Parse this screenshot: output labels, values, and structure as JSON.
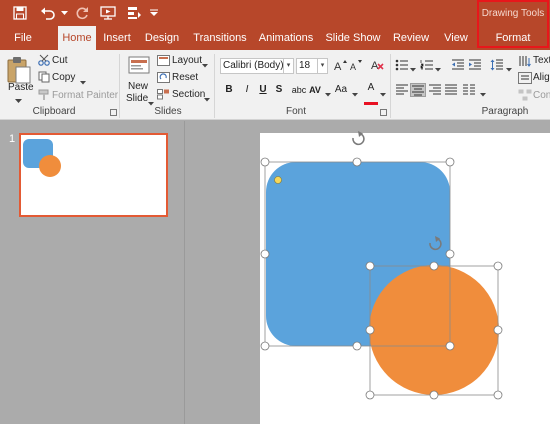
{
  "drawing_tools": {
    "label": "Drawing Tools"
  },
  "qat": [
    {
      "name": "save-icon"
    },
    {
      "name": "undo-icon"
    },
    {
      "name": "redo-icon"
    },
    {
      "name": "start-from-beginning-icon"
    },
    {
      "name": "touch-mouse-mode-icon"
    },
    {
      "name": "customize-qat-icon"
    }
  ],
  "tabs": {
    "file": "File",
    "home": "Home",
    "insert": "Insert",
    "design": "Design",
    "transitions": "Transitions",
    "animations": "Animations",
    "slide_show": "Slide Show",
    "review": "Review",
    "view": "View",
    "format": "Format"
  },
  "active_tab": "Home",
  "ribbon": {
    "clipboard": {
      "label": "Clipboard",
      "paste": "Paste",
      "cut": "Cut",
      "copy": "Copy",
      "format_painter": "Format Painter"
    },
    "slides": {
      "label": "Slides",
      "new_slide_line1": "New",
      "new_slide_line2": "Slide",
      "layout": "Layout",
      "reset": "Reset",
      "section": "Section"
    },
    "font": {
      "label": "Font",
      "font_name": "Calibri (Body)",
      "font_size": "18",
      "bold": "B",
      "italic": "I",
      "underline": "U",
      "strikethrough": "S",
      "shadow": "abc",
      "spacing": "AV",
      "change_case": "Aa",
      "font_color": "A",
      "font_color_value": "#e81123"
    },
    "paragraph": {
      "label": "Paragraph",
      "text_direction": "Text",
      "align_text": "Alig",
      "convert_smartart": "Con"
    }
  },
  "slides": [
    {
      "number": "1",
      "selected": true
    }
  ],
  "colors": {
    "accent": "#b7472a",
    "highlight_border": "#e8161b",
    "rounded_rect_fill": "#5ba3dc",
    "circle_fill": "#f08d3c",
    "thumb_selection": "#e35a34"
  }
}
